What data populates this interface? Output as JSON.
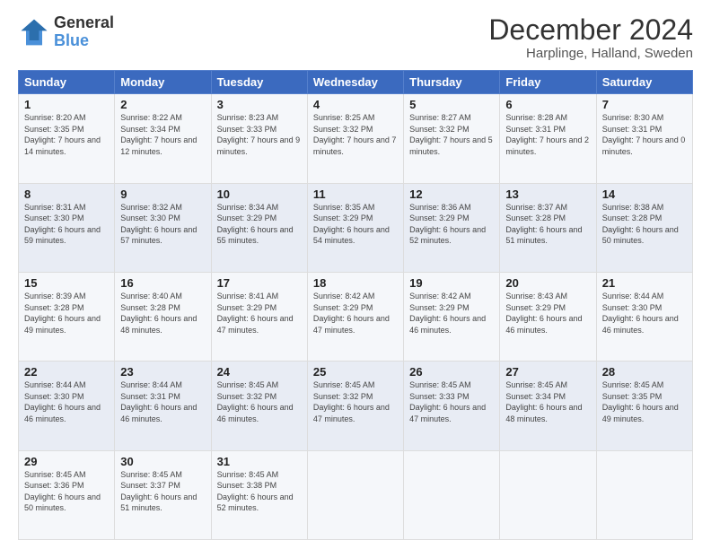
{
  "logo": {
    "line1": "General",
    "line2": "Blue"
  },
  "title": "December 2024",
  "subtitle": "Harplinge, Halland, Sweden",
  "days_header": [
    "Sunday",
    "Monday",
    "Tuesday",
    "Wednesday",
    "Thursday",
    "Friday",
    "Saturday"
  ],
  "weeks": [
    [
      {
        "day": "1",
        "sunrise": "8:20 AM",
        "sunset": "3:35 PM",
        "daylight": "7 hours and 14 minutes."
      },
      {
        "day": "2",
        "sunrise": "8:22 AM",
        "sunset": "3:34 PM",
        "daylight": "7 hours and 12 minutes."
      },
      {
        "day": "3",
        "sunrise": "8:23 AM",
        "sunset": "3:33 PM",
        "daylight": "7 hours and 9 minutes."
      },
      {
        "day": "4",
        "sunrise": "8:25 AM",
        "sunset": "3:32 PM",
        "daylight": "7 hours and 7 minutes."
      },
      {
        "day": "5",
        "sunrise": "8:27 AM",
        "sunset": "3:32 PM",
        "daylight": "7 hours and 5 minutes."
      },
      {
        "day": "6",
        "sunrise": "8:28 AM",
        "sunset": "3:31 PM",
        "daylight": "7 hours and 2 minutes."
      },
      {
        "day": "7",
        "sunrise": "8:30 AM",
        "sunset": "3:31 PM",
        "daylight": "7 hours and 0 minutes."
      }
    ],
    [
      {
        "day": "8",
        "sunrise": "8:31 AM",
        "sunset": "3:30 PM",
        "daylight": "6 hours and 59 minutes."
      },
      {
        "day": "9",
        "sunrise": "8:32 AM",
        "sunset": "3:30 PM",
        "daylight": "6 hours and 57 minutes."
      },
      {
        "day": "10",
        "sunrise": "8:34 AM",
        "sunset": "3:29 PM",
        "daylight": "6 hours and 55 minutes."
      },
      {
        "day": "11",
        "sunrise": "8:35 AM",
        "sunset": "3:29 PM",
        "daylight": "6 hours and 54 minutes."
      },
      {
        "day": "12",
        "sunrise": "8:36 AM",
        "sunset": "3:29 PM",
        "daylight": "6 hours and 52 minutes."
      },
      {
        "day": "13",
        "sunrise": "8:37 AM",
        "sunset": "3:28 PM",
        "daylight": "6 hours and 51 minutes."
      },
      {
        "day": "14",
        "sunrise": "8:38 AM",
        "sunset": "3:28 PM",
        "daylight": "6 hours and 50 minutes."
      }
    ],
    [
      {
        "day": "15",
        "sunrise": "8:39 AM",
        "sunset": "3:28 PM",
        "daylight": "6 hours and 49 minutes."
      },
      {
        "day": "16",
        "sunrise": "8:40 AM",
        "sunset": "3:28 PM",
        "daylight": "6 hours and 48 minutes."
      },
      {
        "day": "17",
        "sunrise": "8:41 AM",
        "sunset": "3:29 PM",
        "daylight": "6 hours and 47 minutes."
      },
      {
        "day": "18",
        "sunrise": "8:42 AM",
        "sunset": "3:29 PM",
        "daylight": "6 hours and 47 minutes."
      },
      {
        "day": "19",
        "sunrise": "8:42 AM",
        "sunset": "3:29 PM",
        "daylight": "6 hours and 46 minutes."
      },
      {
        "day": "20",
        "sunrise": "8:43 AM",
        "sunset": "3:29 PM",
        "daylight": "6 hours and 46 minutes."
      },
      {
        "day": "21",
        "sunrise": "8:44 AM",
        "sunset": "3:30 PM",
        "daylight": "6 hours and 46 minutes."
      }
    ],
    [
      {
        "day": "22",
        "sunrise": "8:44 AM",
        "sunset": "3:30 PM",
        "daylight": "6 hours and 46 minutes."
      },
      {
        "day": "23",
        "sunrise": "8:44 AM",
        "sunset": "3:31 PM",
        "daylight": "6 hours and 46 minutes."
      },
      {
        "day": "24",
        "sunrise": "8:45 AM",
        "sunset": "3:32 PM",
        "daylight": "6 hours and 46 minutes."
      },
      {
        "day": "25",
        "sunrise": "8:45 AM",
        "sunset": "3:32 PM",
        "daylight": "6 hours and 47 minutes."
      },
      {
        "day": "26",
        "sunrise": "8:45 AM",
        "sunset": "3:33 PM",
        "daylight": "6 hours and 47 minutes."
      },
      {
        "day": "27",
        "sunrise": "8:45 AM",
        "sunset": "3:34 PM",
        "daylight": "6 hours and 48 minutes."
      },
      {
        "day": "28",
        "sunrise": "8:45 AM",
        "sunset": "3:35 PM",
        "daylight": "6 hours and 49 minutes."
      }
    ],
    [
      {
        "day": "29",
        "sunrise": "8:45 AM",
        "sunset": "3:36 PM",
        "daylight": "6 hours and 50 minutes."
      },
      {
        "day": "30",
        "sunrise": "8:45 AM",
        "sunset": "3:37 PM",
        "daylight": "6 hours and 51 minutes."
      },
      {
        "day": "31",
        "sunrise": "8:45 AM",
        "sunset": "3:38 PM",
        "daylight": "6 hours and 52 minutes."
      },
      null,
      null,
      null,
      null
    ]
  ]
}
